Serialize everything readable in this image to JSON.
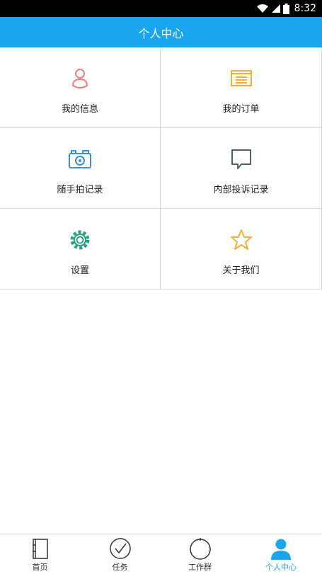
{
  "status_bar": {
    "time": "8:32"
  },
  "header": {
    "title": "个人中心"
  },
  "menu": [
    {
      "label": "我的信息",
      "icon": "user-icon",
      "color": "#f07f7f"
    },
    {
      "label": "我的订单",
      "icon": "order-icon",
      "color": "#f6ad33"
    },
    {
      "label": "随手拍记录",
      "icon": "camera-icon",
      "color": "#3d8ed8"
    },
    {
      "label": "内部投诉记录",
      "icon": "chat-bubble-icon",
      "color": "#50606a"
    },
    {
      "label": "设置",
      "icon": "gear-icon",
      "color": "#2aa383"
    },
    {
      "label": "关于我们",
      "icon": "star-icon",
      "color": "#f6b033"
    }
  ],
  "tabs": [
    {
      "label": "首页",
      "icon": "home-icon",
      "active": false
    },
    {
      "label": "任务",
      "icon": "task-check-icon",
      "active": false
    },
    {
      "label": "工作群",
      "icon": "work-group-icon",
      "active": false
    },
    {
      "label": "个人中心",
      "icon": "profile-icon",
      "active": true
    }
  ],
  "colors": {
    "accent": "#1aa6ef",
    "status_bar": "#000000",
    "divider": "#d9d9d9"
  }
}
